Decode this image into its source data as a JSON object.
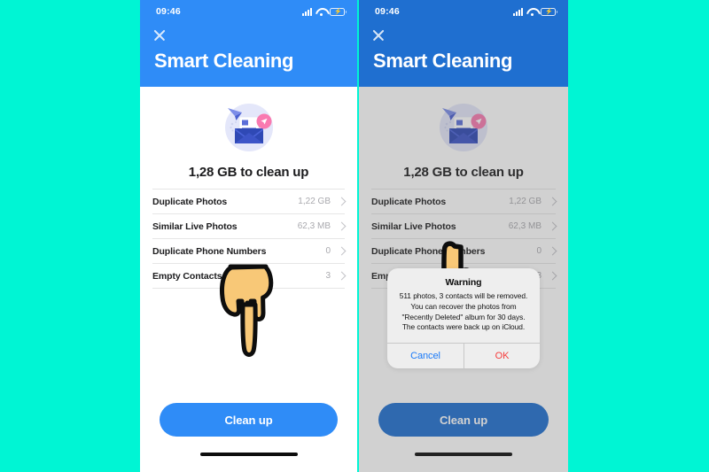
{
  "canvas": {
    "background_color": "#00f5d4"
  },
  "phones": {
    "left": {
      "status": {
        "time": "09:46",
        "signal_icon": "cellular-signal-icon",
        "wifi_icon": "wifi-icon",
        "battery_icon": "battery-low-power-icon"
      },
      "header": {
        "close_icon": "close-icon",
        "title": "Smart Cleaning",
        "background_color": "#2f8cf7"
      },
      "illustration": {
        "icon": "email-document-illustration"
      },
      "summary": "1,28 GB to clean up",
      "rows": [
        {
          "label": "Duplicate Photos",
          "value": "1,22 GB",
          "chevron": "chevron-right-icon"
        },
        {
          "label": "Similar Live Photos",
          "value": "62,3 MB",
          "chevron": "chevron-right-icon"
        },
        {
          "label": "Duplicate Phone Numbers",
          "value": "0",
          "chevron": "chevron-right-icon"
        },
        {
          "label": "Empty Contacts",
          "value": "3",
          "chevron": "chevron-right-icon"
        }
      ],
      "hand_cursor": "hand-pointing-down-icon",
      "cta_label": "Clean up",
      "home_indicator": "home-indicator-bar"
    },
    "right": {
      "status": {
        "time": "09:46",
        "signal_icon": "cellular-signal-icon",
        "wifi_icon": "wifi-icon",
        "battery_icon": "battery-low-power-icon"
      },
      "header": {
        "close_icon": "close-icon",
        "title": "Smart Cleaning",
        "background_color": "#1f6fd0"
      },
      "illustration": {
        "icon": "email-document-illustration"
      },
      "summary": "1,28 GB to clean up",
      "rows": [
        {
          "label": "Duplicate Photos",
          "value": "1,22 GB",
          "chevron": "chevron-right-icon"
        },
        {
          "label": "Similar Live Photos",
          "value": "62,3 MB",
          "chevron": "chevron-right-icon"
        },
        {
          "label": "Duplicate Phone Numbers",
          "value": "0",
          "chevron": "chevron-right-icon"
        },
        {
          "label": "Empty Contacts",
          "value": "3",
          "chevron": "chevron-right-icon"
        }
      ],
      "hand_cursor": "hand-pointing-up-icon",
      "cta_label": "Clean up",
      "home_indicator": "home-indicator-bar",
      "alert": {
        "title": "Warning",
        "message": "511 photos, 3 contacts will be removed. You can recover the photos from \"Recently Deleted\" album for 30 days. The contacts were back up on iCloud.",
        "cancel_label": "Cancel",
        "ok_label": "OK",
        "cancel_color": "#1a7af8",
        "ok_color": "#f63b3b"
      }
    }
  }
}
